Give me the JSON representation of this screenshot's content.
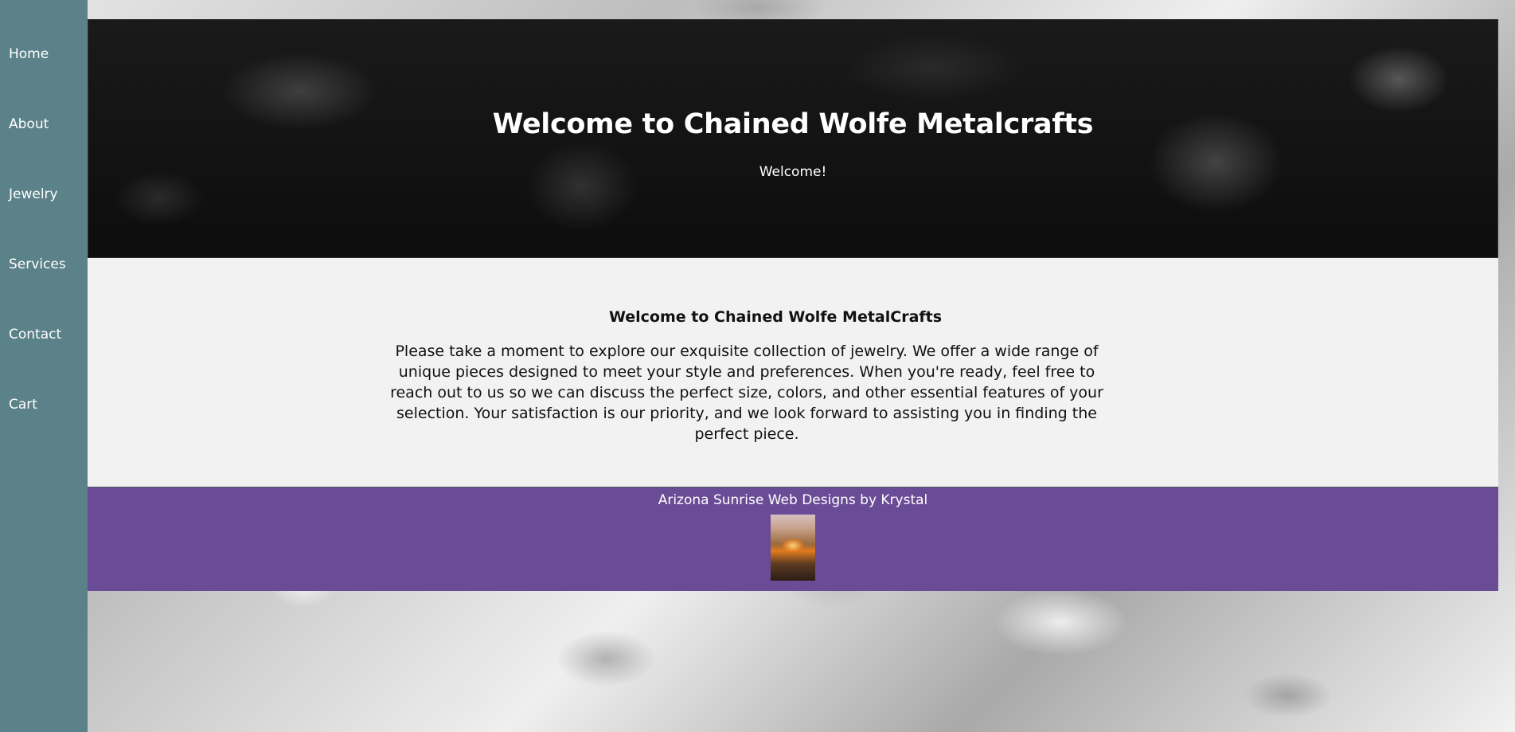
{
  "sidebar": {
    "items": [
      {
        "label": "Home"
      },
      {
        "label": "About"
      },
      {
        "label": "Jewelry"
      },
      {
        "label": "Services"
      },
      {
        "label": "Contact"
      },
      {
        "label": "Cart"
      }
    ]
  },
  "hero": {
    "title": "Welcome to Chained Wolfe Metalcrafts",
    "subtitle": "Welcome!"
  },
  "content": {
    "heading": "Welcome to Chained Wolfe MetalCrafts",
    "body": "Please take a moment to explore our exquisite collection of jewelry. We offer a wide range of unique pieces designed to meet your style and preferences. When you're ready, feel free to reach out to us so we can discuss the perfect size, colors, and other essential features of your selection. Your satisfaction is our priority, and we look forward to assisting you in finding the perfect piece."
  },
  "footer": {
    "credit": "Arizona Sunrise Web Designs by Krystal"
  },
  "colors": {
    "sidebar": "#5b8189",
    "footer": "#6a4b96",
    "content_bg": "#f2f2f2",
    "hero_bg": "#111111"
  }
}
